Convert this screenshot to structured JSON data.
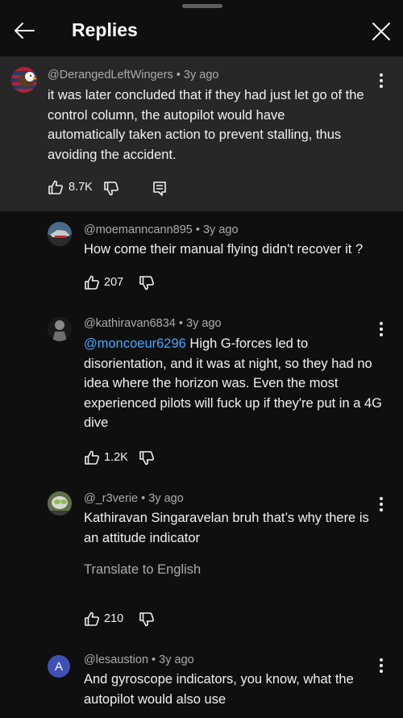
{
  "header": {
    "title": "Replies"
  },
  "parent": {
    "author": "@DerangedLeftWingers",
    "age": "3y ago",
    "text": "it was later concluded that if they had just let go of the control column, the autopilot would have automatically taken action to prevent stalling, thus avoiding the accident.",
    "likes": "8.7K"
  },
  "replies": [
    {
      "author": "@moemanncann895",
      "age": "3y ago",
      "text": "How come their manual flying didn't recover it ?",
      "likes": "207"
    },
    {
      "author": "@kathiravan6834",
      "age": "3y ago",
      "mention": "@moncoeur6296",
      "text": " High G-forces led to disorientation, and it was at night, so they had no idea where the horizon was. Even the most experienced pilots will fuck up if they're put in a 4G dive",
      "likes": "1.2K"
    },
    {
      "author": "@_r3verie",
      "age": "3y ago",
      "text": "Kathiravan Singaravelan bruh that’s why there is an attitude indicator",
      "translate": "Translate to English",
      "likes": "210"
    },
    {
      "author": "@lesaustion",
      "age": "3y ago",
      "avatar_letter": "A",
      "text": "And gyroscope indicators, you know, what the autopilot would also use"
    }
  ],
  "colors": {
    "background": "#0f0f0f",
    "highlight": "#272727",
    "mention": "#3ea6ff",
    "secondary_text": "#aaaaaa",
    "avatar_letter_bg": "#3f51b5"
  },
  "icons": [
    "back-arrow-icon",
    "close-icon",
    "thumbs-up-icon",
    "thumbs-down-icon",
    "reply-icon",
    "more-vert-icon"
  ]
}
